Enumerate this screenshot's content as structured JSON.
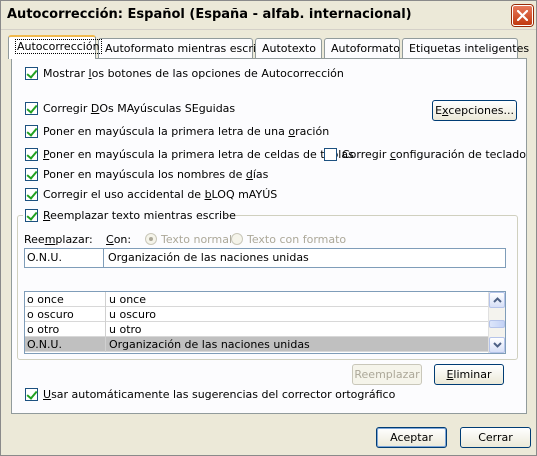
{
  "window": {
    "title": "Autocorrección: Español (España - alfab. internacional)"
  },
  "tabs": [
    {
      "label": "Autocorrección",
      "active": true
    },
    {
      "label": "Autoformato mientras escribe"
    },
    {
      "label": "Autotexto"
    },
    {
      "label": "Autoformato"
    },
    {
      "label": "Etiquetas inteligentes"
    }
  ],
  "options": {
    "show_buttons": {
      "pre": "Mostrar ",
      "key": "l",
      "post": "os botones de las opciones de Autocorrección",
      "checked": true
    },
    "two_caps": {
      "pre": "Corregir ",
      "key": "D",
      "post": "Os MAyúsculas SEguidas",
      "checked": true
    },
    "first_sentence": {
      "pre": "Poner en mayúscula la primera letra de una ",
      "key": "o",
      "post": "ración",
      "checked": true
    },
    "first_cell": {
      "pre": "",
      "key": "P",
      "post": "oner en mayúscula la primera letra de celdas de tablas",
      "checked": true
    },
    "keyboard": {
      "pre": "Corregir ",
      "key": "c",
      "post": "onfiguración de teclado",
      "checked": false
    },
    "day_names": {
      "pre": "Poner en mayúscula los nombres de ",
      "key": "d",
      "post": "ías",
      "checked": true
    },
    "caps_lock": {
      "pre": "Corregir el uso accidental de ",
      "key": "b",
      "post": "LOQ mAYÚS",
      "checked": true
    },
    "replace_text": {
      "pre": "",
      "key": "R",
      "post": "eemplazar texto mientras escribe",
      "checked": true
    },
    "use_suggestions": {
      "pre": "",
      "key": "U",
      "post": "sar automáticamente las sugerencias del corrector ortográfico",
      "checked": true
    }
  },
  "buttons": {
    "exceptions": {
      "pre": "",
      "key": "x",
      "post": "cepciones...",
      "first": "E"
    },
    "replace": "Reemplazar",
    "delete": {
      "key": "E",
      "post": "liminar"
    },
    "ok": "Aceptar",
    "cancel": "Cerrar"
  },
  "replace_section": {
    "replace_label_pre": "Ree",
    "replace_label_key": "m",
    "replace_label_post": "plazar:",
    "with_label_key": "C",
    "with_label_post": "on:",
    "plain_text": "Texto normal",
    "formatted_text": "Texto con formato",
    "plain_selected": true,
    "replace_value": "O.N.U.",
    "with_value": "Organización de las naciones unidas"
  },
  "entries": [
    {
      "replace": "o once",
      "with": "u once"
    },
    {
      "replace": "o oscuro",
      "with": "u oscuro"
    },
    {
      "replace": "o otro",
      "with": "u otro"
    },
    {
      "replace": "O.N.U.",
      "with": "Organización de las naciones unidas",
      "selected": true
    }
  ]
}
